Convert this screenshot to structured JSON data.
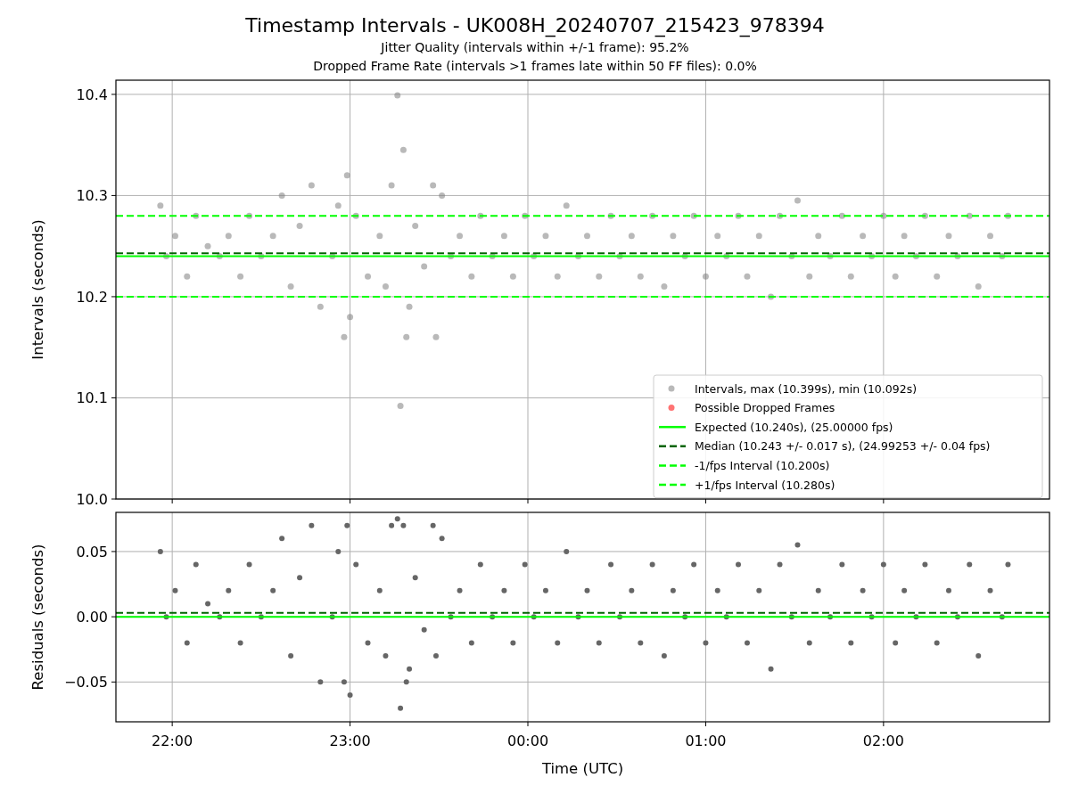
{
  "figure": {
    "title": "Timestamp Intervals - UK008H_20240707_215423_978394",
    "subtitles": [
      "Jitter Quality (intervals within +/-1 frame): 95.2%",
      "Dropped Frame Rate (intervals >1 frames late within 50 FF files): 0.0%"
    ],
    "upper_plot": {
      "chart_data": {
        "type": "scatter",
        "ylabel": "Intervals (seconds)",
        "grid": true,
        "legend": true,
        "xlim": [
          "2024-07-07T21:41",
          "2024-07-08T02:56"
        ],
        "ylim": [
          10.0,
          10.414
        ],
        "yticks": [
          {
            "value": 10.0,
            "label": "10.0"
          },
          {
            "value": 10.1,
            "label": "10.1"
          },
          {
            "value": 10.2,
            "label": "10.2"
          },
          {
            "value": 10.3,
            "label": "10.3"
          },
          {
            "value": 10.4,
            "label": "10.4"
          }
        ],
        "series": [
          {
            "name": "Intervals, max (10.399s), min (10.092s)",
            "color": "#808080",
            "x": [
              "2024-07-07T21:56",
              "2024-07-07T21:58",
              "2024-07-07T22:01",
              "2024-07-07T22:05",
              "2024-07-07T22:08",
              "2024-07-07T22:12",
              "2024-07-07T22:16",
              "2024-07-07T22:19",
              "2024-07-07T22:23",
              "2024-07-07T22:26",
              "2024-07-07T22:30",
              "2024-07-07T22:34",
              "2024-07-07T22:37",
              "2024-07-07T22:40",
              "2024-07-07T22:43",
              "2024-07-07T22:47",
              "2024-07-07T22:50",
              "2024-07-07T22:54",
              "2024-07-07T22:56",
              "2024-07-07T22:58",
              "2024-07-07T22:59",
              "2024-07-07T23:00",
              "2024-07-07T23:02",
              "2024-07-07T23:06",
              "2024-07-07T23:10",
              "2024-07-07T23:12",
              "2024-07-07T23:14",
              "2024-07-07T23:16",
              "2024-07-07T23:17",
              "2024-07-07T23:18",
              "2024-07-07T23:19",
              "2024-07-07T23:20",
              "2024-07-07T23:22",
              "2024-07-07T23:25",
              "2024-07-07T23:28",
              "2024-07-07T23:29",
              "2024-07-07T23:31",
              "2024-07-07T23:34",
              "2024-07-07T23:37",
              "2024-07-07T23:41",
              "2024-07-07T23:44",
              "2024-07-07T23:48",
              "2024-07-07T23:52",
              "2024-07-07T23:55",
              "2024-07-07T23:59",
              "2024-07-08T00:02",
              "2024-07-08T00:06",
              "2024-07-08T00:10",
              "2024-07-08T00:13",
              "2024-07-08T00:17",
              "2024-07-08T00:20",
              "2024-07-08T00:24",
              "2024-07-08T00:28",
              "2024-07-08T00:31",
              "2024-07-08T00:35",
              "2024-07-08T00:38",
              "2024-07-08T00:42",
              "2024-07-08T00:46",
              "2024-07-08T00:49",
              "2024-07-08T00:53",
              "2024-07-08T00:56",
              "2024-07-08T01:00",
              "2024-07-08T01:04",
              "2024-07-08T01:07",
              "2024-07-08T01:11",
              "2024-07-08T01:14",
              "2024-07-08T01:18",
              "2024-07-08T01:22",
              "2024-07-08T01:25",
              "2024-07-08T01:29",
              "2024-07-08T01:31",
              "2024-07-08T01:35",
              "2024-07-08T01:38",
              "2024-07-08T01:42",
              "2024-07-08T01:46",
              "2024-07-08T01:49",
              "2024-07-08T01:53",
              "2024-07-08T01:56",
              "2024-07-08T02:00",
              "2024-07-08T02:04",
              "2024-07-08T02:07",
              "2024-07-08T02:11",
              "2024-07-08T02:14",
              "2024-07-08T02:18",
              "2024-07-08T02:22",
              "2024-07-08T02:25",
              "2024-07-08T02:29",
              "2024-07-08T02:32",
              "2024-07-08T02:36",
              "2024-07-08T02:40",
              "2024-07-08T02:42"
            ],
            "values": [
              10.29,
              10.24,
              10.26,
              10.22,
              10.28,
              10.25,
              10.24,
              10.26,
              10.22,
              10.28,
              10.24,
              10.26,
              10.3,
              10.21,
              10.27,
              10.31,
              10.19,
              10.24,
              10.29,
              10.16,
              10.32,
              10.18,
              10.28,
              10.22,
              10.26,
              10.21,
              10.31,
              10.399,
              10.092,
              10.345,
              10.16,
              10.19,
              10.27,
              10.23,
              10.31,
              10.16,
              10.3,
              10.24,
              10.26,
              10.22,
              10.28,
              10.24,
              10.26,
              10.22,
              10.28,
              10.24,
              10.26,
              10.22,
              10.29,
              10.24,
              10.26,
              10.22,
              10.28,
              10.24,
              10.26,
              10.22,
              10.28,
              10.21,
              10.26,
              10.24,
              10.28,
              10.22,
              10.26,
              10.24,
              10.28,
              10.22,
              10.26,
              10.2,
              10.28,
              10.24,
              10.295,
              10.22,
              10.26,
              10.24,
              10.28,
              10.22,
              10.26,
              10.24,
              10.28,
              10.22,
              10.26,
              10.24,
              10.28,
              10.22,
              10.26,
              10.24,
              10.28,
              10.21,
              10.26,
              10.24,
              10.28
            ]
          },
          {
            "name": "Possible Dropped Frames",
            "color": "#ff0000"
          }
        ],
        "ref_lines": [
          {
            "axis": "y",
            "value": 10.24,
            "label": "Expected (10.240s), (25.00000 fps)",
            "color": "#00ff00"
          },
          {
            "axis": "y",
            "value": 10.243,
            "label": "Median (10.243 +/- 0.017 s), (24.99253 +/- 0.04 fps)",
            "color": "#006400"
          },
          {
            "axis": "y",
            "value": 10.2,
            "label": "-1/fps Interval (10.200s)",
            "color": "#00ff00"
          },
          {
            "axis": "y",
            "value": 10.28,
            "label": "+1/fps Interval (10.280s)",
            "color": "#00ff00"
          }
        ]
      }
    },
    "lower_plot": {
      "chart_data": {
        "type": "scatter",
        "xlabel": "Time (UTC)",
        "ylabel": "Residuals (seconds)",
        "grid": true,
        "xlim": [
          "2024-07-07T21:41",
          "2024-07-08T02:56"
        ],
        "ylim": [
          -0.0805,
          0.08
        ],
        "xticks": [
          {
            "value": "2024-07-07T22:00",
            "label": "22:00"
          },
          {
            "value": "2024-07-07T23:00",
            "label": "23:00"
          },
          {
            "value": "2024-07-08T00:00",
            "label": "00:00"
          },
          {
            "value": "2024-07-08T01:00",
            "label": "01:00"
          },
          {
            "value": "2024-07-08T02:00",
            "label": "02:00"
          }
        ],
        "yticks": [
          {
            "value": -0.05,
            "label": "−0.05"
          },
          {
            "value": 0,
            "label": "0.00"
          },
          {
            "value": 0.05,
            "label": "0.05"
          }
        ],
        "series": [
          {
            "color": "#666666",
            "x": [
              "2024-07-07T21:56",
              "2024-07-07T21:58",
              "2024-07-07T22:01",
              "2024-07-07T22:05",
              "2024-07-07T22:08",
              "2024-07-07T22:12",
              "2024-07-07T22:16",
              "2024-07-07T22:19",
              "2024-07-07T22:23",
              "2024-07-07T22:26",
              "2024-07-07T22:30",
              "2024-07-07T22:34",
              "2024-07-07T22:37",
              "2024-07-07T22:40",
              "2024-07-07T22:43",
              "2024-07-07T22:47",
              "2024-07-07T22:50",
              "2024-07-07T22:54",
              "2024-07-07T22:56",
              "2024-07-07T22:58",
              "2024-07-07T22:59",
              "2024-07-07T23:00",
              "2024-07-07T23:02",
              "2024-07-07T23:06",
              "2024-07-07T23:10",
              "2024-07-07T23:12",
              "2024-07-07T23:14",
              "2024-07-07T23:16",
              "2024-07-07T23:17",
              "2024-07-07T23:18",
              "2024-07-07T23:19",
              "2024-07-07T23:20",
              "2024-07-07T23:22",
              "2024-07-07T23:25",
              "2024-07-07T23:28",
              "2024-07-07T23:29",
              "2024-07-07T23:31",
              "2024-07-07T23:34",
              "2024-07-07T23:37",
              "2024-07-07T23:41",
              "2024-07-07T23:44",
              "2024-07-07T23:48",
              "2024-07-07T23:52",
              "2024-07-07T23:55",
              "2024-07-07T23:59",
              "2024-07-08T00:02",
              "2024-07-08T00:06",
              "2024-07-08T00:10",
              "2024-07-08T00:13",
              "2024-07-08T00:17",
              "2024-07-08T00:20",
              "2024-07-08T00:24",
              "2024-07-08T00:28",
              "2024-07-08T00:31",
              "2024-07-08T00:35",
              "2024-07-08T00:38",
              "2024-07-08T00:42",
              "2024-07-08T00:46",
              "2024-07-08T00:49",
              "2024-07-08T00:53",
              "2024-07-08T00:56",
              "2024-07-08T01:00",
              "2024-07-08T01:04",
              "2024-07-08T01:07",
              "2024-07-08T01:11",
              "2024-07-08T01:14",
              "2024-07-08T01:18",
              "2024-07-08T01:22",
              "2024-07-08T01:25",
              "2024-07-08T01:29",
              "2024-07-08T01:31",
              "2024-07-08T01:35",
              "2024-07-08T01:38",
              "2024-07-08T01:42",
              "2024-07-08T01:46",
              "2024-07-08T01:49",
              "2024-07-08T01:53",
              "2024-07-08T01:56",
              "2024-07-08T02:00",
              "2024-07-08T02:04",
              "2024-07-08T02:07",
              "2024-07-08T02:11",
              "2024-07-08T02:14",
              "2024-07-08T02:18",
              "2024-07-08T02:22",
              "2024-07-08T02:25",
              "2024-07-08T02:29",
              "2024-07-08T02:32",
              "2024-07-08T02:36",
              "2024-07-08T02:40",
              "2024-07-08T02:42"
            ],
            "values": [
              0.05,
              0,
              0.02,
              -0.02,
              0.04,
              0.01,
              0,
              0.02,
              -0.02,
              0.04,
              0,
              0.02,
              0.06,
              -0.03,
              0.03,
              0.07,
              -0.05,
              0,
              0.05,
              -0.05,
              0.07,
              -0.06,
              0.04,
              -0.02,
              0.02,
              -0.03,
              0.07,
              0.075,
              -0.07,
              0.07,
              -0.05,
              -0.04,
              0.03,
              -0.01,
              0.07,
              -0.03,
              0.06,
              0,
              0.02,
              -0.02,
              0.04,
              0,
              0.02,
              -0.02,
              0.04,
              0,
              0.02,
              -0.02,
              0.05,
              0,
              0.02,
              -0.02,
              0.04,
              0,
              0.02,
              -0.02,
              0.04,
              -0.03,
              0.02,
              0,
              0.04,
              -0.02,
              0.02,
              0,
              0.04,
              -0.02,
              0.02,
              -0.04,
              0.04,
              0,
              0.055,
              -0.02,
              0.02,
              0,
              0.04,
              -0.02,
              0.02,
              0,
              0.04,
              -0.02,
              0.02,
              0,
              0.04,
              -0.02,
              0.02,
              0,
              0.04,
              -0.03,
              0.02,
              0,
              0.04
            ]
          }
        ],
        "ref_lines": [
          {
            "axis": "y",
            "value": 0,
            "color": "#00ff00"
          },
          {
            "axis": "y",
            "value": 0.003,
            "color": "#006400"
          }
        ]
      }
    }
  }
}
